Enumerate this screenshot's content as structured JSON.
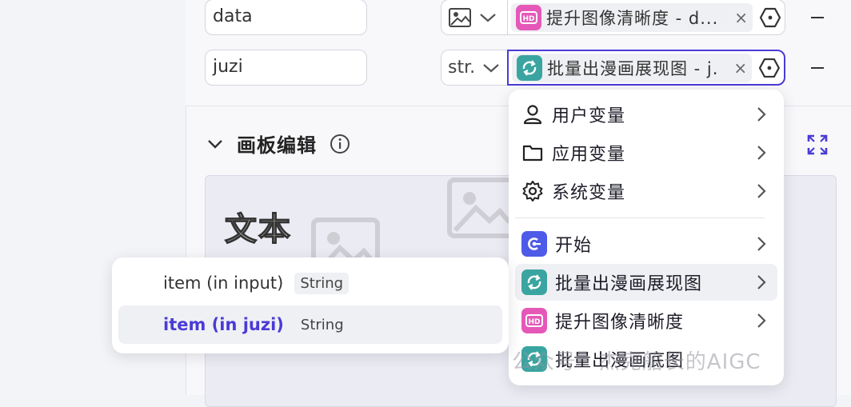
{
  "variables": [
    {
      "name": "data",
      "type_icon": "image-icon",
      "ref_icon": "hd-icon",
      "ref_text": "提升图像清晰度 - d...",
      "active": false
    },
    {
      "name": "juzi",
      "type_label": "str.",
      "ref_icon": "loop-icon",
      "ref_text": "批量出漫画展现图 - j.",
      "active": true
    }
  ],
  "section": {
    "title": "画板编辑"
  },
  "canvas": {
    "text": "文本"
  },
  "menu": {
    "items": [
      {
        "label": "用户变量",
        "icon": "user-icon"
      },
      {
        "label": "应用变量",
        "icon": "folder-icon"
      },
      {
        "label": "系统变量",
        "icon": "gear-icon"
      },
      {
        "label": "开始",
        "icon": "start-icon"
      },
      {
        "label": "批量出漫画展现图",
        "icon": "loop-icon"
      },
      {
        "label": "提升图像清晰度",
        "icon": "hd-icon"
      },
      {
        "label": "批量出漫画底图",
        "icon": "loop-icon"
      }
    ]
  },
  "submenu": {
    "items": [
      {
        "label": "item (in input)",
        "type": "String"
      },
      {
        "label": "item (in juzi)",
        "type": "String"
      }
    ]
  },
  "watermark": "公众号 · 杰克船长的AIGC",
  "colors": {
    "accent": "#4a3bd6",
    "hd_badge": "#e558b8",
    "loop_badge": "#3aa5a0",
    "start_badge": "#4e5ae8"
  }
}
